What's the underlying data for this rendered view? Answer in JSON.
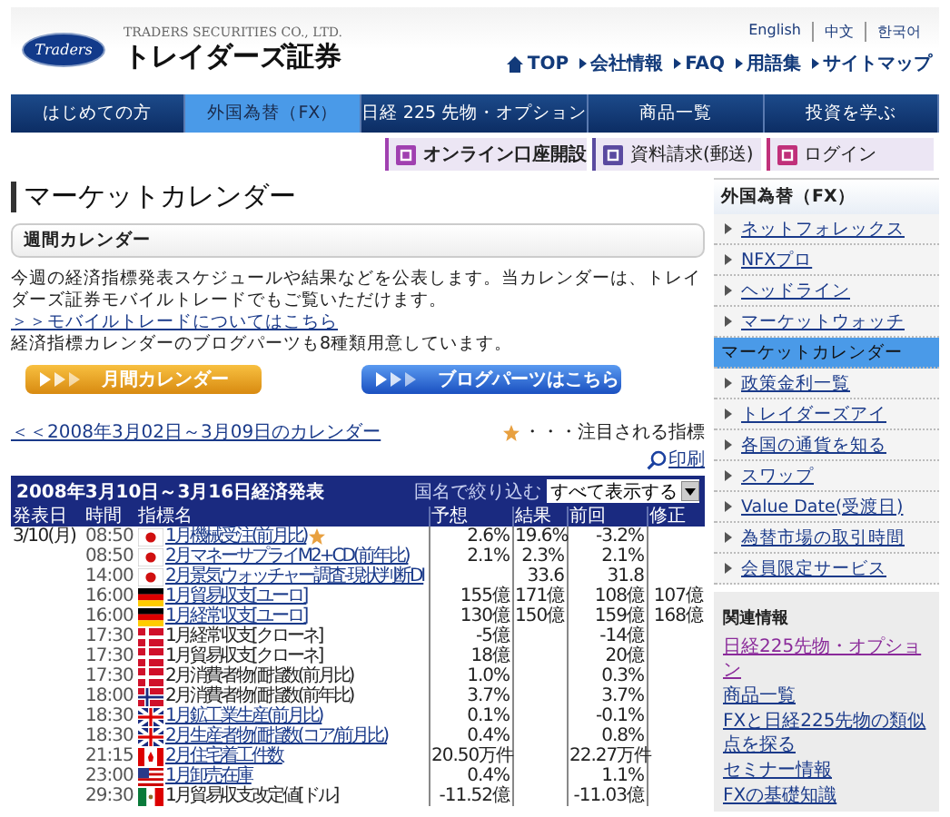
{
  "header": {
    "logo_text": "Traders",
    "company_en": "TRADERS SECURITIES CO., LTD.",
    "company_ja": "トレイダーズ証券",
    "languages": [
      "English",
      "中文",
      "한국어"
    ],
    "links": [
      {
        "label": "TOP",
        "kind": "home"
      },
      {
        "label": "会社情報",
        "kind": "arrow"
      },
      {
        "label": "FAQ",
        "kind": "arrow"
      },
      {
        "label": "用語集",
        "kind": "arrow"
      },
      {
        "label": "サイトマップ",
        "kind": "arrow"
      }
    ]
  },
  "nav": {
    "tabs": [
      {
        "label": "はじめての方",
        "selected": false
      },
      {
        "label": "外国為替（FX）",
        "selected": true
      },
      {
        "label": "日経 225 先物・オプション",
        "selected": false
      },
      {
        "label": "商品一覧",
        "selected": false
      },
      {
        "label": "投資を学ぶ",
        "selected": false
      }
    ],
    "actions": [
      {
        "label": "オンライン口座開設",
        "color": "#a040b0",
        "bold": true
      },
      {
        "label": "資料請求(郵送)",
        "color": "#5a4aa0",
        "bold": false
      },
      {
        "label": "ログイン",
        "color": "#c0307a",
        "bold": false
      }
    ]
  },
  "main": {
    "title": "マーケットカレンダー",
    "section": "週間カレンダー",
    "intro": "今週の経済指標発表スケジュールや結果などを公表します。当カレンダーは、トレイダーズ証券モバイルトレードでもご覧いただけます。",
    "mobile_link": "＞＞モバイルトレードについてはこちら",
    "blog_note": "経済指標カレンダーのブログパーツも8種類用意しています。",
    "buttons": [
      {
        "label": "月間カレンダー",
        "kind": "orange"
      },
      {
        "label": "ブログパーツはこちら",
        "kind": "blue"
      }
    ],
    "prev_week": "＜＜2008年3月02日～3月09日のカレンダー",
    "legend": "・・・注目される指標",
    "print": "印刷",
    "table": {
      "title": "2008年3月10日～3月16日経済発表",
      "filter_label": "国名で絞り込む",
      "filter_value": "すべて表示する",
      "columns": [
        "発表日",
        "時間",
        "指標名",
        "予想",
        "結果",
        "前回",
        "修正"
      ],
      "rows": [
        {
          "date": "3/10(月)",
          "time": "08:50",
          "kind": "jp",
          "name": "1月機械受注(前月比)",
          "link": true,
          "starred": true,
          "forecast": "2.6%",
          "result": "19.6%",
          "previous": "-3.2%"
        },
        {
          "time": "08:50",
          "kind": "jp",
          "name": "2月マネーサプライM2+CD(前年比)",
          "link": true,
          "starred": false,
          "forecast": "2.1%",
          "result": "2.3%",
          "previous": "2.1%"
        },
        {
          "time": "14:00",
          "kind": "jp",
          "name": "2月景気ウォッチャー調査-現状判断DI",
          "link": true,
          "starred": false,
          "result": "33.6",
          "previous": "31.8"
        },
        {
          "time": "16:00",
          "kind": "de",
          "name": "1月貿易収支[ユーロ]",
          "link": true,
          "starred": false,
          "forecast": "155億",
          "result": "171億",
          "previous": "108億",
          "revised": "107億"
        },
        {
          "time": "16:00",
          "kind": "de",
          "name": "1月経常収支[ユーロ]",
          "link": true,
          "starred": false,
          "forecast": "130億",
          "result": "150億",
          "previous": "159億",
          "revised": "168億"
        },
        {
          "time": "17:30",
          "kind": "dk",
          "name": "1月経常収支[クローネ]",
          "link": false,
          "starred": false,
          "forecast": "-5億",
          "previous": "-14億"
        },
        {
          "time": "17:30",
          "kind": "dk",
          "name": "1月貿易収支[クローネ]",
          "link": false,
          "starred": false,
          "forecast": "18億",
          "previous": "20億"
        },
        {
          "time": "17:30",
          "kind": "dk",
          "name": "2月消費者物価指数(前月比)",
          "link": false,
          "starred": false,
          "forecast": "1.0%",
          "previous": "0.3%"
        },
        {
          "time": "18:00",
          "kind": "no",
          "name": "2月消費者物価指数(前年比)",
          "link": false,
          "starred": false,
          "forecast": "3.7%",
          "previous": "3.7%"
        },
        {
          "time": "18:30",
          "kind": "gb",
          "name": "1月鉱工業生産(前月比)",
          "link": true,
          "starred": false,
          "forecast": "0.1%",
          "previous": "-0.1%"
        },
        {
          "time": "18:30",
          "kind": "gb",
          "name": "2月生産者物価指数(コア/前月比)",
          "link": true,
          "starred": false,
          "forecast": "0.4%",
          "previous": "0.8%"
        },
        {
          "time": "21:15",
          "kind": "ca",
          "name": "2月住宅着工件数",
          "link": true,
          "starred": false,
          "forecast": "20.50万件",
          "previous": "22.27万件"
        },
        {
          "time": "23:00",
          "kind": "us",
          "name": "1月卸売在庫",
          "link": true,
          "starred": false,
          "forecast": "0.4%",
          "previous": "1.1%"
        },
        {
          "time": "29:30",
          "kind": "mx",
          "name": "1月貿易収支改定値[ドル]",
          "link": false,
          "starred": false,
          "forecast": "-11.52億",
          "previous": "-11.03億"
        }
      ]
    }
  },
  "sidebar": {
    "title": "外国為替（FX）",
    "items": [
      {
        "label": "ネットフォレックス",
        "selected": false
      },
      {
        "label": "NFXプロ",
        "selected": false
      },
      {
        "label": "ヘッドライン",
        "selected": false
      },
      {
        "label": "マーケットウォッチ",
        "selected": false
      },
      {
        "label": "マーケットカレンダー",
        "selected": true
      },
      {
        "label": "政策金利一覧",
        "selected": false
      },
      {
        "label": "トレイダーズアイ",
        "selected": false
      },
      {
        "label": "各国の通貨を知る",
        "selected": false
      },
      {
        "label": "スワップ",
        "selected": false
      },
      {
        "label": "Value Date(受渡日)",
        "selected": false
      },
      {
        "label": "為替市場の取引時間",
        "selected": false
      },
      {
        "label": "会員限定サービス",
        "selected": false
      }
    ],
    "related_title": "関連情報",
    "related": [
      {
        "label": "日経225先物・オプション",
        "visited": true
      },
      {
        "label": "商品一覧",
        "visited": false
      },
      {
        "label": "FXと日経225先物の類似点を探る",
        "visited": false
      },
      {
        "label": "セミナー情報",
        "visited": false
      },
      {
        "label": "FXの基礎知識",
        "visited": false
      }
    ]
  }
}
